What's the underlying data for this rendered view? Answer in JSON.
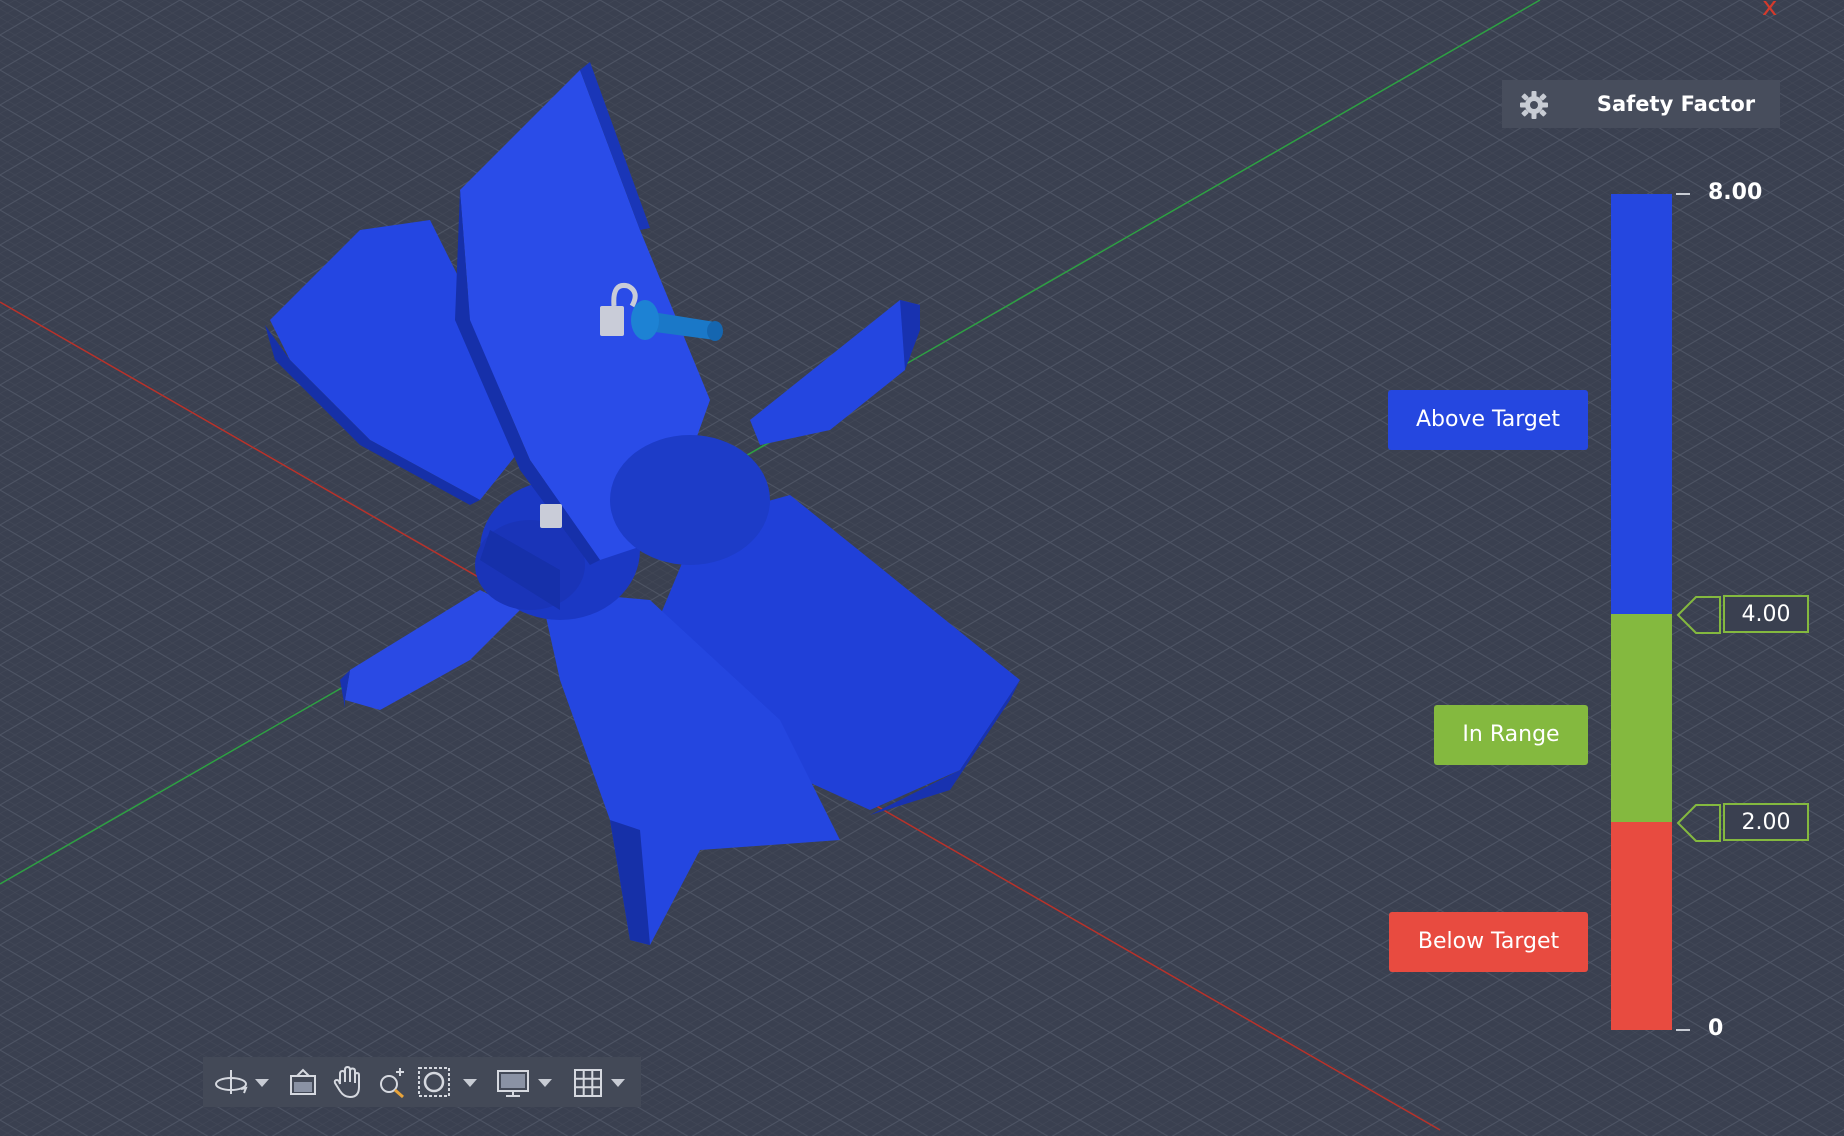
{
  "window": {
    "close_glyph": "x"
  },
  "legend": {
    "title": "Safety Factor",
    "settings_icon": "gear-icon",
    "max_label": "8.00",
    "min_label": "0",
    "upper_threshold": "4.00",
    "lower_threshold": "2.00",
    "ranges": {
      "above": {
        "label": "Above Target",
        "color": "#2547e0"
      },
      "in_range": {
        "label": "In Range",
        "color": "#84b93f"
      },
      "below": {
        "label": "Below Target",
        "color": "#e84b40"
      }
    }
  },
  "model": {
    "color": "#1f3fd6",
    "shaft_color": "#1a78c8"
  },
  "axes": {
    "x_color": "#c0392b",
    "y_color": "#2ea043"
  },
  "navbar": {
    "items": [
      "orbit-icon",
      "caret-down-icon",
      "look-at-icon",
      "pan-icon",
      "zoom-icon",
      "fit-window-icon",
      "caret-down-icon",
      "display-settings-icon",
      "caret-down-icon",
      "grid-icon",
      "caret-down-icon"
    ]
  }
}
